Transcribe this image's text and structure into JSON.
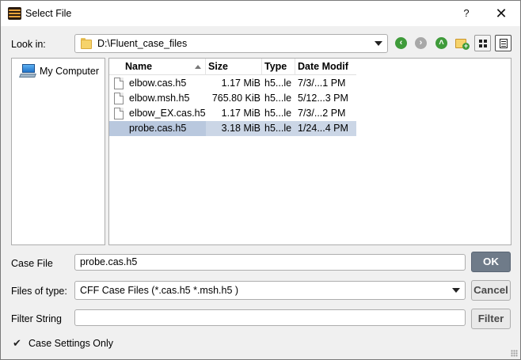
{
  "window": {
    "title": "Select File",
    "help_label": "?",
    "close_label": "✕"
  },
  "toolbar": {
    "look_in_label": "Look in:",
    "look_in_value": "D:\\Fluent_case_files",
    "icons": [
      "back-icon",
      "forward-icon",
      "up-folder-icon",
      "new-folder-icon",
      "icon-view-icon",
      "detail-view-icon"
    ]
  },
  "sidebar": {
    "items": [
      {
        "label": "My Computer",
        "icon": "computer-icon"
      }
    ]
  },
  "file_list": {
    "columns": [
      "Name",
      "Size",
      "Type",
      "Date Modif"
    ],
    "rows": [
      {
        "name": "elbow.cas.h5",
        "size": "1.17 MiB",
        "type": "h5...le",
        "date": "7/3/...1 PM",
        "selected": false
      },
      {
        "name": "elbow.msh.h5",
        "size": "765.80 KiB",
        "type": "h5...le",
        "date": "5/12...3 PM",
        "selected": false
      },
      {
        "name": "elbow_EX.cas.h5",
        "size": "1.17 MiB",
        "type": "h5...le",
        "date": "7/3/...2 PM",
        "selected": false
      },
      {
        "name": "probe.cas.h5",
        "size": "3.18 MiB",
        "type": "h5...le",
        "date": "1/24...4 PM",
        "selected": true
      }
    ]
  },
  "case_file": {
    "label": "Case File",
    "value": "probe.cas.h5"
  },
  "files_of_type": {
    "label": "Files of type:",
    "value": "CFF Case Files (*.cas.h5 *.msh.h5 )"
  },
  "filter_string": {
    "label": "Filter String",
    "value": ""
  },
  "buttons": {
    "ok": "OK",
    "cancel": "Cancel",
    "filter": "Filter"
  },
  "case_settings_only": {
    "label": "Case Settings Only",
    "checked": true,
    "check_glyph": "✔"
  }
}
